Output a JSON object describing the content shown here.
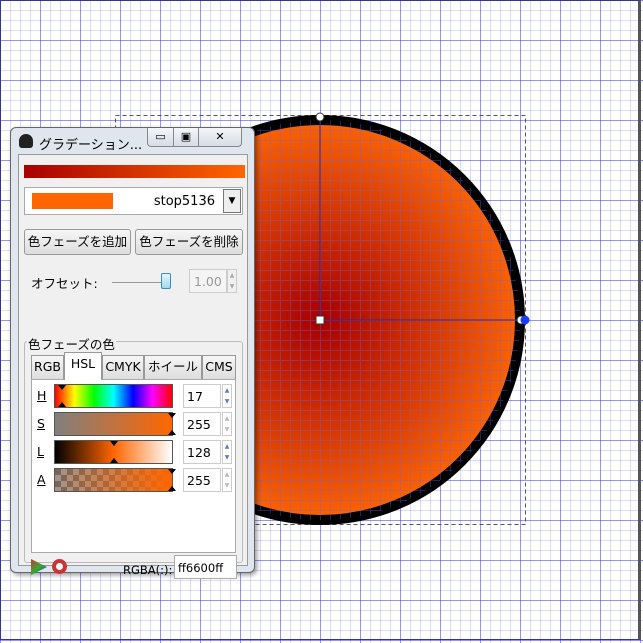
{
  "dialog": {
    "title": "グラデーション...",
    "window_buttons": {
      "minimize": "▭",
      "maximize": "▣",
      "close": "✕"
    },
    "stop": {
      "name": "stop5136",
      "color": "#ff6600"
    },
    "gradient": {
      "start": "#a60000",
      "end": "#ff6600"
    },
    "add_stop": "色フェーズを追加",
    "delete_stop": "色フェーズを削除",
    "offset_label": "オフセット:",
    "offset_value": "1.00",
    "offset_fraction": 1.0,
    "color_frame_title": "色フェーズの色",
    "tabs": [
      "RGB",
      "HSL",
      "CMYK",
      "ホイール",
      "CMS"
    ],
    "active_tab": "HSL",
    "channels": [
      {
        "label": "H",
        "value": "17"
      },
      {
        "label": "S",
        "value": "255"
      },
      {
        "label": "L",
        "value": "128"
      },
      {
        "label": "A",
        "value": "255"
      }
    ],
    "rgba_label": "RGBA(:):",
    "rgba_value": "ff6600ff"
  }
}
